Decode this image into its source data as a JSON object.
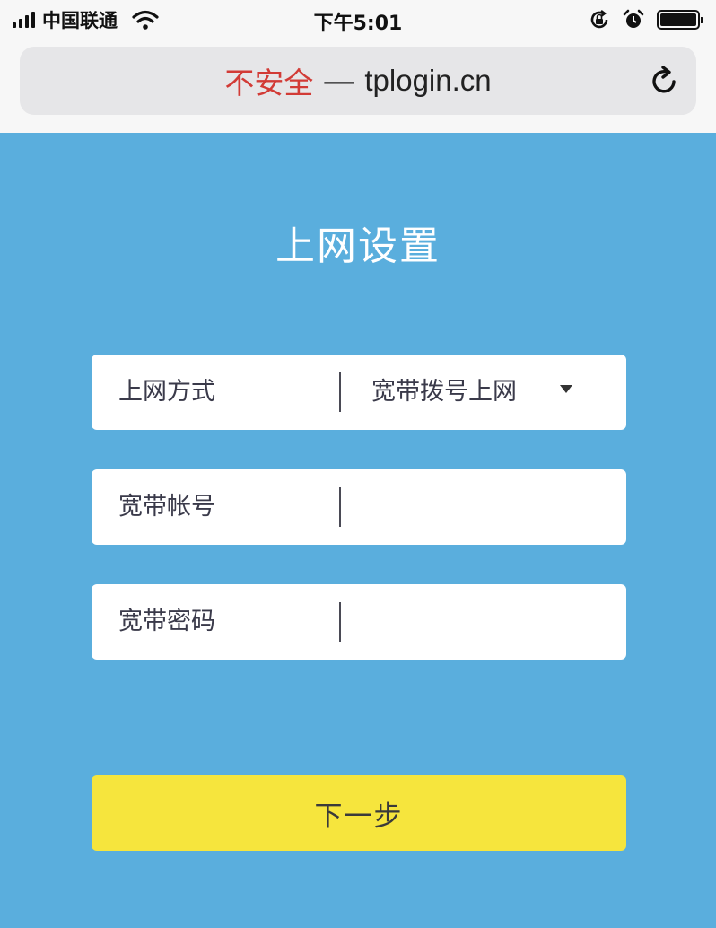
{
  "status_bar": {
    "carrier": "中国联通",
    "time": "下午5:01"
  },
  "address_bar": {
    "security_label": "不安全",
    "separator": "—",
    "domain": "tplogin.cn"
  },
  "page": {
    "title": "上网设置",
    "fields": {
      "connection_type": {
        "label": "上网方式",
        "value": "宽带拨号上网"
      },
      "account": {
        "label": "宽带帐号",
        "value": ""
      },
      "password": {
        "label": "宽带密码",
        "value": ""
      }
    },
    "next_label": "下一步"
  },
  "colors": {
    "background": "#5aaedd",
    "insecure": "#d23b36",
    "button": "#f6e53d"
  }
}
